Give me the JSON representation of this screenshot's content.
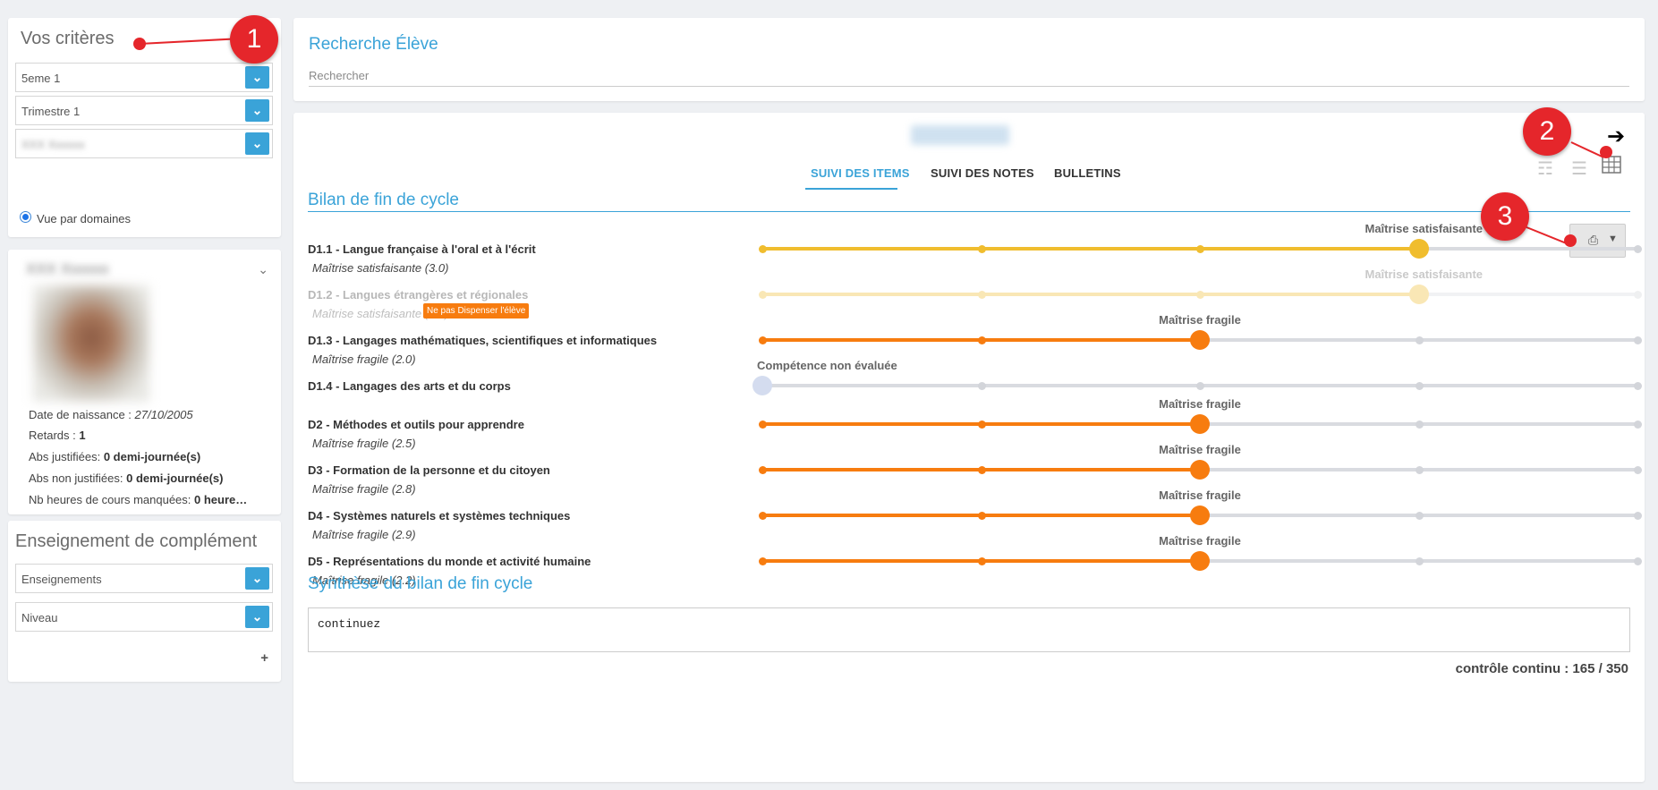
{
  "criteria": {
    "title": "Vos critères",
    "class_select": "5eme 1",
    "period_select": "Trimestre 1",
    "student_select": "XXX Xxxxxx",
    "radio_label": "Vue par domaines"
  },
  "student": {
    "name": "XXX Xxxxxx",
    "birth_label": "Date de naissance :",
    "birth_value": "27/10/2005",
    "late_label": "Retards :",
    "late_value": "1",
    "abs_just_label": "Abs justifiées:",
    "abs_just_value": "0 demi-journée(s)",
    "abs_nonjust_label": "Abs non justifiées:",
    "abs_nonjust_value": "0 demi-journée(s)",
    "missed_label": "Nb heures de cours manquées:",
    "missed_value": "0 heure…"
  },
  "enseignement": {
    "title": "Enseignement de complément",
    "select1": "Enseignements",
    "select2": "Niveau",
    "add": "+"
  },
  "search": {
    "title": "Recherche Élève",
    "placeholder": "Rechercher"
  },
  "main": {
    "tabs": [
      "SUIVI DES ITEMS",
      "SUIVI DES NOTES",
      "BULLETINS"
    ],
    "section_title": "Bilan de fin de cycle",
    "controle": "contrôle continu : 165 / 350",
    "synthese_title": "Synthèse du bilan de fin cycle",
    "synthese_text": "continuez"
  },
  "colors": {
    "satisfaisante": "#f0bd2e",
    "fragile": "#f77c0f",
    "non_evaluee": "#d4dcef",
    "accent": "#3aa3d8"
  },
  "domains": [
    {
      "label": "D1.1 - Langue française à l'oral et à l'écrit",
      "sub": "Maîtrise satisfaisante (3.0)",
      "level": "Maîtrise satisfaisante",
      "step": 3,
      "kind": "satisfaisante",
      "faded": false,
      "badge": ""
    },
    {
      "label": "D1.2 - Langues étrangères et régionales",
      "sub": "Maîtrise satisfaisante (3.1)",
      "level": "Maîtrise satisfaisante",
      "step": 3,
      "kind": "satisfaisante",
      "faded": true,
      "badge": "Ne pas Dispenser l'élève"
    },
    {
      "label": "D1.3 - Langages mathématiques, scientifiques et informatiques",
      "sub": "Maîtrise fragile (2.0)",
      "level": "Maîtrise fragile",
      "step": 2,
      "kind": "fragile",
      "faded": false,
      "badge": ""
    },
    {
      "label": "D1.4 - Langages des arts et du corps",
      "sub": "",
      "level": "Compétence non évaluée",
      "step": 0,
      "kind": "non_evaluee",
      "faded": false,
      "badge": ""
    },
    {
      "label": "D2 - Méthodes et outils pour apprendre",
      "sub": "Maîtrise fragile (2.5)",
      "level": "Maîtrise fragile",
      "step": 2,
      "kind": "fragile",
      "faded": false,
      "badge": ""
    },
    {
      "label": "D3 - Formation de la personne et du citoyen",
      "sub": "Maîtrise fragile (2.8)",
      "level": "Maîtrise fragile",
      "step": 2,
      "kind": "fragile",
      "faded": false,
      "badge": ""
    },
    {
      "label": "D4 - Systèmes naturels et systèmes techniques",
      "sub": "Maîtrise fragile (2.9)",
      "level": "Maîtrise fragile",
      "step": 2,
      "kind": "fragile",
      "faded": false,
      "badge": ""
    },
    {
      "label": "D5 - Représentations du monde et activité humaine",
      "sub": "Maîtrise fragile (2.2)",
      "level": "Maîtrise fragile",
      "step": 2,
      "kind": "fragile",
      "faded": false,
      "badge": ""
    }
  ],
  "callouts": [
    "1",
    "2",
    "3"
  ],
  "icons": {
    "arrow": "arrow-right-icon",
    "layers": "layers-icon",
    "lines": "align-icon",
    "grid": "table-icon",
    "printer": "printer-icon"
  }
}
